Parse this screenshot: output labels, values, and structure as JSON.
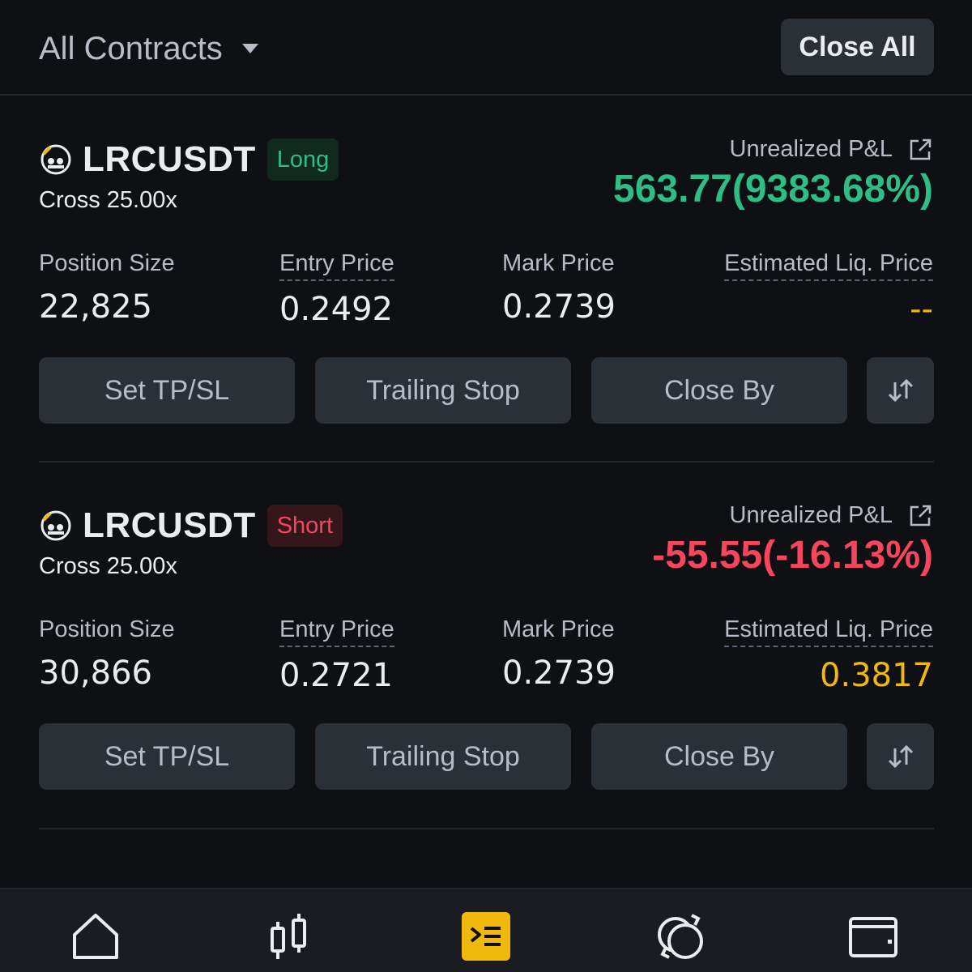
{
  "header": {
    "filter_label": "All Contracts",
    "close_all_label": "Close All"
  },
  "positions": [
    {
      "symbol": "LRCUSDT",
      "side": "Long",
      "margin_mode": "Cross 25.00x",
      "pnl_label": "Unrealized P&L",
      "pnl_value": "563.77(9383.68%)",
      "size_label": "Position Size",
      "size_value": "22,825",
      "entry_label": "Entry Price",
      "entry_value": "0.2492",
      "mark_label": "Mark Price",
      "mark_value": "0.2739",
      "liq_label": "Estimated Liq. Price",
      "liq_value": "--",
      "btn_tpsl": "Set TP/SL",
      "btn_trailing": "Trailing Stop",
      "btn_closeby": "Close By"
    },
    {
      "symbol": "LRCUSDT",
      "side": "Short",
      "margin_mode": "Cross 25.00x",
      "pnl_label": "Unrealized P&L",
      "pnl_value": "-55.55(-16.13%)",
      "size_label": "Position Size",
      "size_value": "30,866",
      "entry_label": "Entry Price",
      "entry_value": "0.2721",
      "mark_label": "Mark Price",
      "mark_value": "0.2739",
      "liq_label": "Estimated Liq. Price",
      "liq_value": "0.3817",
      "btn_tpsl": "Set TP/SL",
      "btn_trailing": "Trailing Stop",
      "btn_closeby": "Close By"
    }
  ],
  "nav": {
    "items": [
      "home-icon",
      "markets-icon",
      "positions-icon",
      "trade-icon",
      "wallet-icon"
    ],
    "active": "positions-icon"
  },
  "colors": {
    "background": "#0f1013",
    "long": "#2ebd85",
    "short": "#f6465d",
    "accent": "#f0b90b",
    "button": "#2b2f36"
  }
}
